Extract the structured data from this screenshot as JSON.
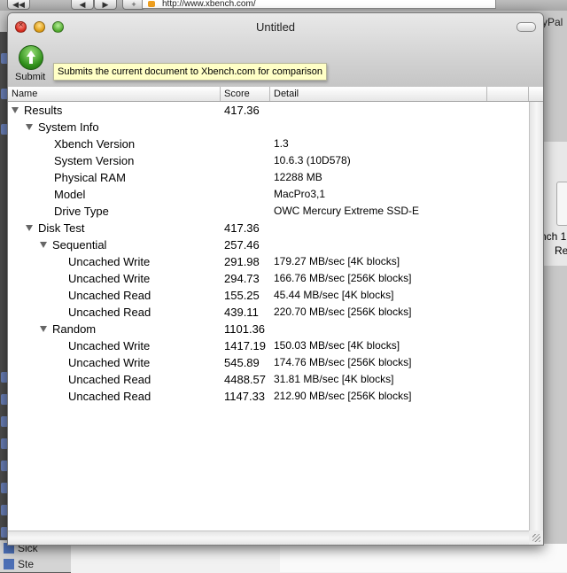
{
  "background": {
    "url": "http://www.xbench.com/",
    "tab_fragment": "yPal",
    "right_text_1": "nch 1",
    "right_text_2": "Re",
    "bottom_items": [
      "Sick",
      "Ste"
    ]
  },
  "window": {
    "title": "Untitled"
  },
  "toolbar": {
    "submit_label": "Submit",
    "tooltip": "Submits the current document to Xbench.com for comparison"
  },
  "columns": {
    "name": "Name",
    "score": "Score",
    "detail": "Detail"
  },
  "rows": [
    {
      "name": "Results",
      "score": "417.36",
      "detail": "",
      "level": 0,
      "expandable": true
    },
    {
      "name": "System Info",
      "score": "",
      "detail": "",
      "level": 1,
      "expandable": true
    },
    {
      "name": "Xbench Version",
      "score": "",
      "detail": "1.3",
      "level": 2,
      "expandable": false
    },
    {
      "name": "System Version",
      "score": "",
      "detail": "10.6.3 (10D578)",
      "level": 2,
      "expandable": false
    },
    {
      "name": "Physical RAM",
      "score": "",
      "detail": "12288 MB",
      "level": 2,
      "expandable": false
    },
    {
      "name": "Model",
      "score": "",
      "detail": "MacPro3,1",
      "level": 2,
      "expandable": false
    },
    {
      "name": "Drive Type",
      "score": "",
      "detail": "OWC Mercury Extreme SSD-E",
      "level": 2,
      "expandable": false
    },
    {
      "name": "Disk Test",
      "score": "417.36",
      "detail": "",
      "level": 1,
      "expandable": true
    },
    {
      "name": "Sequential",
      "score": "257.46",
      "detail": "",
      "level": 2,
      "expandable": true
    },
    {
      "name": "Uncached Write",
      "score": "291.98",
      "detail": "179.27 MB/sec [4K blocks]",
      "level": 3,
      "expandable": false
    },
    {
      "name": "Uncached Write",
      "score": "294.73",
      "detail": "166.76 MB/sec [256K blocks]",
      "level": 3,
      "expandable": false
    },
    {
      "name": "Uncached Read",
      "score": "155.25",
      "detail": "45.44 MB/sec [4K blocks]",
      "level": 3,
      "expandable": false
    },
    {
      "name": "Uncached Read",
      "score": "439.11",
      "detail": "220.70 MB/sec [256K blocks]",
      "level": 3,
      "expandable": false
    },
    {
      "name": "Random",
      "score": "1101.36",
      "detail": "",
      "level": 2,
      "expandable": true
    },
    {
      "name": "Uncached Write",
      "score": "1417.19",
      "detail": "150.03 MB/sec [4K blocks]",
      "level": 3,
      "expandable": false
    },
    {
      "name": "Uncached Write",
      "score": "545.89",
      "detail": "174.76 MB/sec [256K blocks]",
      "level": 3,
      "expandable": false
    },
    {
      "name": "Uncached Read",
      "score": "4488.57",
      "detail": "31.81 MB/sec [4K blocks]",
      "level": 3,
      "expandable": false
    },
    {
      "name": "Uncached Read",
      "score": "1147.33",
      "detail": "212.90 MB/sec [256K blocks]",
      "level": 3,
      "expandable": false
    }
  ]
}
